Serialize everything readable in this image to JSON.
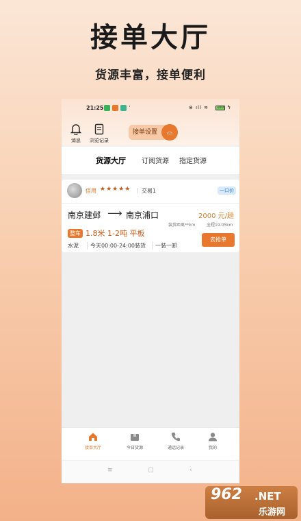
{
  "promo": {
    "title": "接单大厅",
    "subtitle": "货源丰富，接单便利"
  },
  "statusbar": {
    "time": "21:25",
    "dot": "·",
    "right_icons": "⊗ ıll ≋",
    "battery": "100",
    "bolt": "ϟ"
  },
  "header": {
    "messages_label": "消息",
    "history_label": "浏览记录",
    "order_settings_label": "接单设置",
    "order_settings_icon": "⌓"
  },
  "tabs": [
    "货源大厅",
    "订阅货源",
    "指定货源"
  ],
  "listing": {
    "credit_label": "信用",
    "stars": "★★★★★",
    "separator": "|",
    "trade_label": "交易1",
    "price_type": "一口价",
    "from": "南京建邺",
    "arrow": "⟶",
    "to": "南京浦口",
    "price": "2000 元/趟",
    "pickup_distance": "装货距离**km",
    "total_distance": "全程19.05km",
    "vehicle_tag": "整车",
    "spec": "1.8米 1-2吨 平板",
    "goods": "水泥",
    "load_time": "今天00:00-24:00装货",
    "load_method": "一装一卸",
    "grab_button": "去抢单"
  },
  "bottom_nav": [
    {
      "label": "接单大厅",
      "active": true
    },
    {
      "label": "今日货源",
      "active": false
    },
    {
      "label": "通话记录",
      "active": false
    },
    {
      "label": "我的",
      "active": false
    }
  ],
  "system_nav": {
    "menu": "≡",
    "home": "▢",
    "back": "‹"
  },
  "watermark": {
    "number": "962",
    "net": ".NET",
    "cn": "乐游网"
  },
  "colors": {
    "accent": "#e8782d",
    "price": "#d4822f",
    "badge_blue": "#2b7dd6"
  }
}
